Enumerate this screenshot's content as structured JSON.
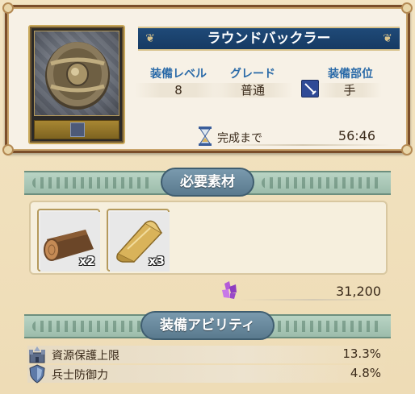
{
  "item": {
    "name": "ラウンドバックラー",
    "equip_level_label": "装備レベル",
    "equip_level": "8",
    "grade_label": "グレード",
    "grade": "普通",
    "slot_label": "装備部位",
    "slot": "手",
    "timer_label": "完成まで",
    "timer_value": "56:46"
  },
  "materials": {
    "title": "必要素材",
    "items": [
      {
        "icon": "log-icon",
        "qty": "x2"
      },
      {
        "icon": "scroll-icon",
        "qty": "x3"
      }
    ],
    "cost_icon": "purple-gem-icon",
    "cost": "31,200"
  },
  "abilities": {
    "title": "装備アビリティ",
    "rows": [
      {
        "icon": "castle-icon",
        "label": "資源保護上限",
        "value": "13.3%"
      },
      {
        "icon": "shield-icon",
        "label": "兵士防御力",
        "value": "4.8%"
      }
    ]
  },
  "colors": {
    "banner": "#1f4a78",
    "stat_label": "#2a6aa8",
    "frame": "#7a4e2a",
    "section_header": "#9cbcab"
  }
}
